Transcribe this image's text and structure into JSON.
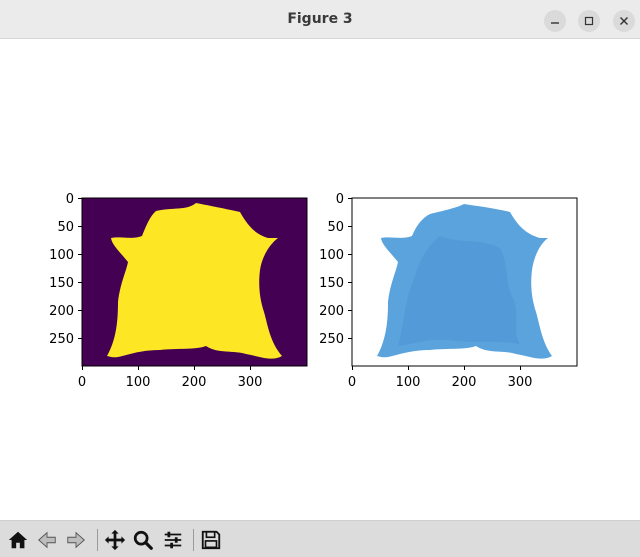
{
  "window": {
    "title": "Figure 3"
  },
  "plots": [
    {
      "name": "mask",
      "x_ticks": [
        "0",
        "100",
        "200",
        "300"
      ],
      "y_ticks": [
        "0",
        "50",
        "100",
        "150",
        "200",
        "250"
      ]
    },
    {
      "name": "image",
      "x_ticks": [
        "0",
        "100",
        "200",
        "300"
      ],
      "y_ticks": [
        "0",
        "50",
        "100",
        "150",
        "200",
        "250"
      ]
    }
  ],
  "colors": {
    "mask_bg": "#440154",
    "mask_fg": "#fde725",
    "hide": "#5aa3dd"
  },
  "toolbar": [
    "home-icon",
    "back-icon",
    "forward-icon",
    "pan-icon",
    "zoom-icon",
    "configure-icon",
    "save-icon"
  ]
}
